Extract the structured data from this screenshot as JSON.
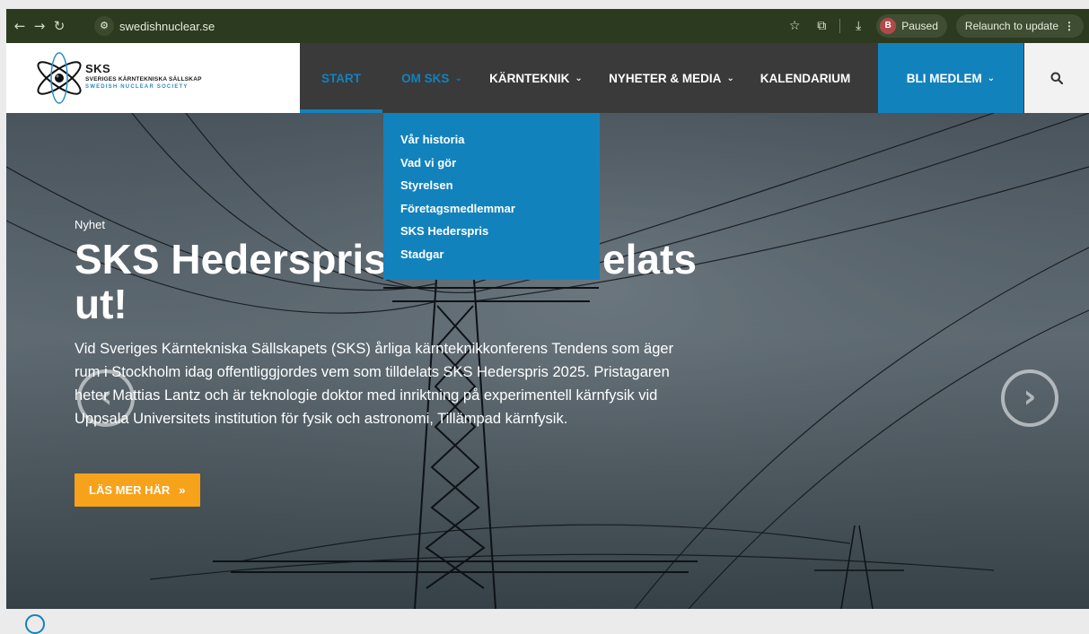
{
  "browser": {
    "url": "swedishnuclear.se",
    "profile_initial": "B",
    "profile_status": "Paused",
    "relaunch_label": "Relaunch to update",
    "icons": [
      "back-icon",
      "forward-icon",
      "reload-icon",
      "site-info-icon",
      "star-icon",
      "extensions-icon",
      "download-icon",
      "menu-icon"
    ]
  },
  "logo": {
    "line1": "SKS",
    "line2": "SVERIGES KÄRNTEKNISKA SÄLLSKAP",
    "line3": "SWEDISH NUCLEAR SOCIETY"
  },
  "nav": {
    "start": "START",
    "om_sks": "OM SKS",
    "karnteknik": "KÄRNTEKNIK",
    "nyheter": "NYHETER & MEDIA",
    "kalendarium": "KALENDARIUM",
    "bli_medlem": "BLI MEDLEM"
  },
  "dropdown": {
    "items": [
      "Vår historia",
      "Vad vi gör",
      "Styrelsen",
      "Företagsmedlemmar",
      "SKS Hederspris",
      "Stadgar"
    ]
  },
  "hero": {
    "tag": "Nyhet",
    "title": "SKS Hederspris 2025 har delats ut!",
    "body": "Vid Sveriges Kärntekniska Sällskapets (SKS) årliga kärnteknikkonferens Tendens som äger rum i Stockholm idag offentliggjordes vem som tilldelats SKS Hederspris 2025. Pristagaren heter Mattias Lantz och är teknologie doktor med inriktning på experimentell kärnfysik vid Uppsala Universitets institution för fysik och astronomi, Tillämpad kärnfysik.",
    "cta": "LÄS MER HÄR",
    "cta_icon": "»"
  },
  "colors": {
    "brand_blue": "#1282bd",
    "cta_orange": "#f7a21b",
    "header_dark": "#3a3a3a"
  }
}
